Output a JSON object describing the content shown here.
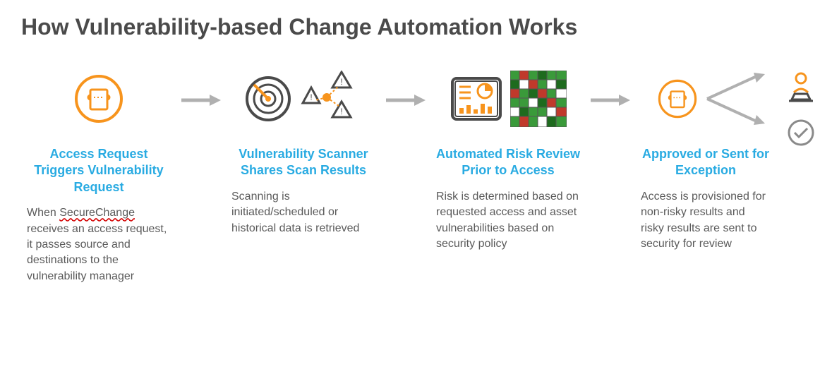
{
  "title": "How Vulnerability-based Change Automation Works",
  "steps": [
    {
      "title": "Access Request Triggers Vulnerability Request",
      "body_pre": "When ",
      "body_spell": "SecureChange",
      "body_post": " receives an access request, it passes source and destinations to the vulnerability manager"
    },
    {
      "title": "Vulnerability Scanner Shares Scan Results",
      "body": "Scanning is initiated/scheduled or historical data is retrieved"
    },
    {
      "title": "Automated Risk Review Prior to Access",
      "body": "Risk is determined based on requested access and asset vulnerabilities based on security policy"
    },
    {
      "title": "Approved or Sent for Exception",
      "body": "Access is provisioned for non-risky results and risky results are sent to security for review"
    }
  ]
}
